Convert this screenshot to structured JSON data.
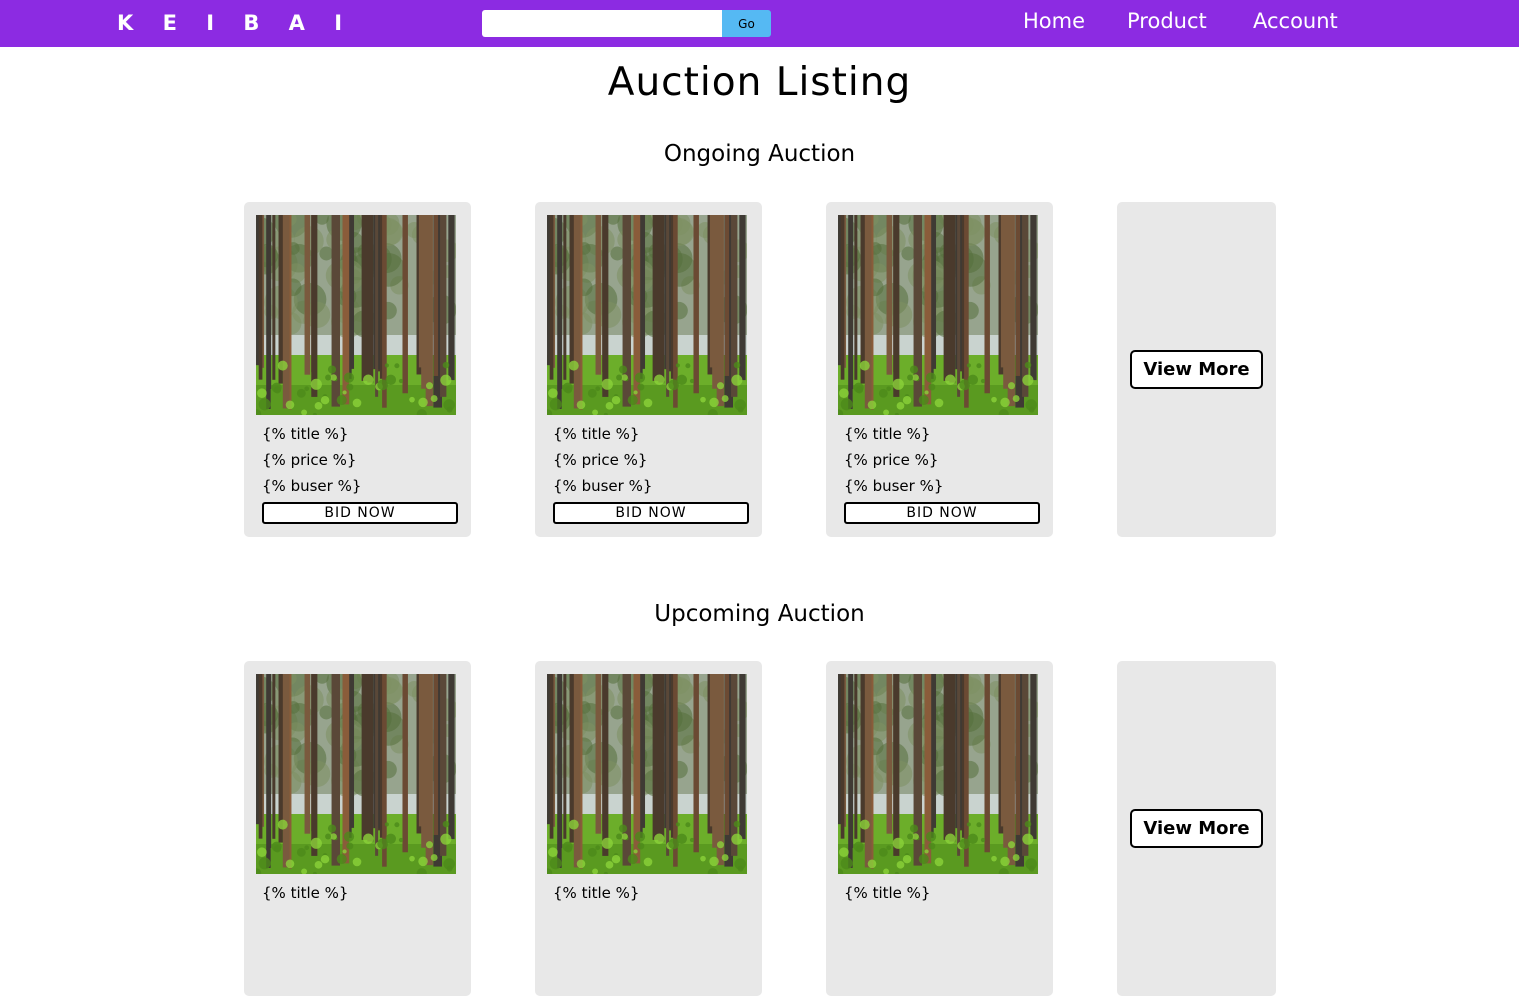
{
  "navbar": {
    "brand": "K E I B A I",
    "search": {
      "value": "",
      "placeholder": "",
      "button_label": "Go"
    },
    "links": [
      "Home",
      "Product",
      "Account"
    ],
    "color": "#8c2be2",
    "go_button_color": "#55b9f3"
  },
  "page_title": "Auction Listing",
  "sections": [
    {
      "title": "Ongoing Auction",
      "cards": [
        {
          "title": "{% title %}",
          "price": "{% price %}",
          "buser": "{% buser %}",
          "button": "BID NOW"
        },
        {
          "title": "{% title %}",
          "price": "{% price %}",
          "buser": "{% buser %}",
          "button": "BID NOW"
        },
        {
          "title": "{% title %}",
          "price": "{% price %}",
          "buser": "{% buser %}",
          "button": "BID NOW"
        }
      ],
      "view_more": "View More"
    },
    {
      "title": "Upcoming Auction",
      "cards": [
        {
          "title": "{% title %}"
        },
        {
          "title": "{% title %}"
        },
        {
          "title": "{% title %}"
        }
      ],
      "view_more": "View More"
    }
  ],
  "card_image": "forest-photo",
  "card_background": "#e8e8e8"
}
